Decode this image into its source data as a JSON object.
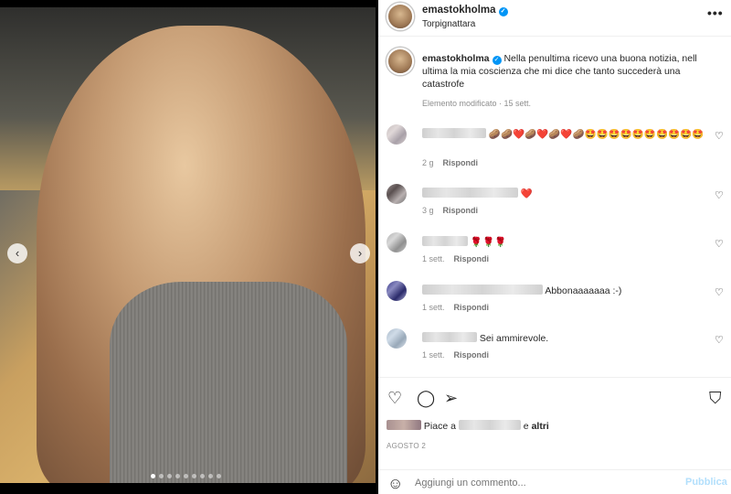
{
  "post": {
    "username": "emastokholma",
    "location": "Torpignattara",
    "more_label": "•••",
    "carousel": {
      "prev_label": "‹",
      "next_label": "›",
      "dot_count": 9,
      "active_dot": 0
    }
  },
  "caption": {
    "username": "emastokholma",
    "text": "Nella penultima ricevo una buona notizia, nell ultima la mia coscienza che mi dice che tanto succederà una catastrofe",
    "meta": "Elemento modificato · 15 sett."
  },
  "comments": [
    {
      "text": "🥔🥔❤️🥔❤️🥔❤️🥔🤩🤩🤩🤩🤩🤩🤩🤩🤩🤩",
      "time": "2 g",
      "reply": "Rispondi"
    },
    {
      "text": "❤️",
      "time": "3 g",
      "reply": "Rispondi"
    },
    {
      "text": "🌹🌹🌹",
      "time": "1 sett.",
      "reply": "Rispondi"
    },
    {
      "text": "Abbonaaaaaaa :-)",
      "time": "1 sett.",
      "reply": "Rispondi"
    },
    {
      "text": "Sei ammirevole.",
      "time": "1 sett.",
      "reply": "Rispondi"
    }
  ],
  "actions": {
    "likes_prefix": "Piace a",
    "likes_conj": "e",
    "likes_others": "altri",
    "date": "AGOSTO 2"
  },
  "composer": {
    "placeholder": "Aggiungi un commento...",
    "publish_label": "Pubblica"
  },
  "icons": {
    "heart": "heart-icon",
    "comment": "comment-icon",
    "share": "share-icon",
    "bookmark": "bookmark-icon",
    "emoji": "emoji-icon",
    "verified": "verified-icon"
  },
  "colors": {
    "accent": "#0095f6",
    "publish_disabled": "#b2dffc",
    "muted": "#8e8e8e"
  }
}
